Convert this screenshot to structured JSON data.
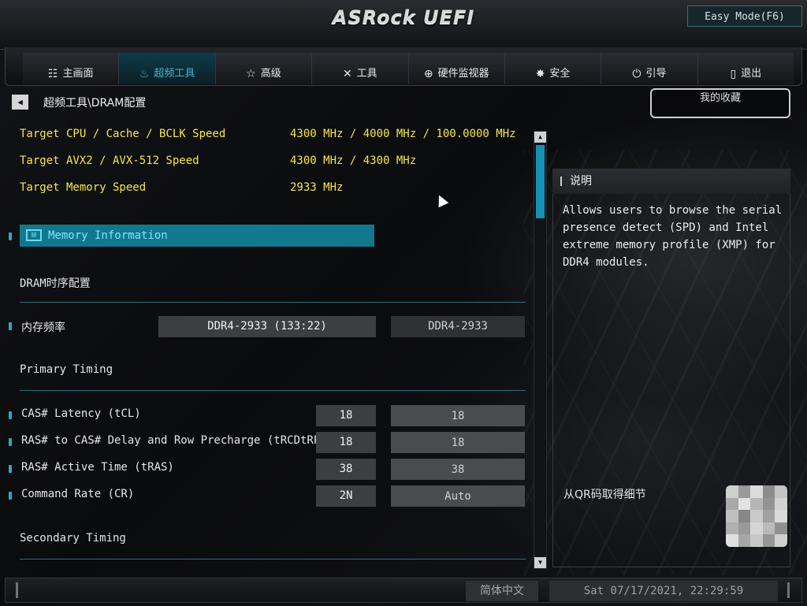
{
  "header": {
    "logo_text": "ASRock UEFI",
    "easy_mode_label": "Easy Mode(F6)"
  },
  "tabs": [
    {
      "label": "主画面",
      "icon": "list-icon",
      "glyph": "☷"
    },
    {
      "label": "超频工具",
      "icon": "flame-icon",
      "glyph": "♨"
    },
    {
      "label": "高级",
      "icon": "star-icon",
      "glyph": "☆"
    },
    {
      "label": "工具",
      "icon": "tools-icon",
      "glyph": "✕"
    },
    {
      "label": "硬件监视器",
      "icon": "target-icon",
      "glyph": "⊕"
    },
    {
      "label": "安全",
      "icon": "shield-gear-icon",
      "glyph": "✸"
    },
    {
      "label": "引导",
      "icon": "power-icon",
      "glyph": "⏻"
    },
    {
      "label": "退出",
      "icon": "exit-door-icon",
      "glyph": "▯"
    }
  ],
  "active_tab_index": 1,
  "breadcrumb": {
    "back_glyph": "◀",
    "path": "超频工具\\DRAM配置"
  },
  "favorites_label": "我的收藏",
  "targets": [
    {
      "label": "Target CPU / Cache / BCLK Speed",
      "value": "4300 MHz / 4000 MHz / 100.0000 MHz"
    },
    {
      "label": "Target AVX2 / AVX-512 Speed",
      "value": "4300 MHz / 4300 MHz"
    },
    {
      "label": "Target Memory Speed",
      "value": "2933 MHz"
    }
  ],
  "memory_info": {
    "label": "Memory Information",
    "icon": "memory-module-icon",
    "glyph": "▤"
  },
  "sections": {
    "dram_timing": "DRAM时序配置",
    "primary_timing": "Primary Timing",
    "secondary_timing": "Secondary Timing"
  },
  "memory_frequency": {
    "label": "内存频率",
    "current": "DDR4-2933 (133:22)",
    "selected": "DDR4-2933"
  },
  "primary_items": [
    {
      "label": "CAS# Latency (tCL)",
      "current": "18",
      "selected": "18"
    },
    {
      "label": "RAS# to CAS# Delay and Row Precharge (tRCDtRP)",
      "current": "18",
      "selected": "18"
    },
    {
      "label": "RAS# Active Time (tRAS)",
      "current": "38",
      "selected": "38"
    },
    {
      "label": "Command Rate (CR)",
      "current": "2N",
      "selected": "Auto"
    }
  ],
  "scrollbar": {
    "up_glyph": "▲",
    "down_glyph": "▼",
    "position_fraction": 0.0
  },
  "description": {
    "title": "说明",
    "text": "Allows users to browse the serial\npresence detect (SPD) and Intel\nextreme memory profile (XMP) for\nDDR4 modules."
  },
  "qr": {
    "label": "从QR码取得细节",
    "icon": "qr-code-icon"
  },
  "footer": {
    "language": "简体中文",
    "datetime": "Sat 07/17/2021, 22:29:59"
  },
  "colors": {
    "accent": "#12788d",
    "highlight_text": "#7fe4ff",
    "target_text": "#f4e74a",
    "active_tab_text": "#3fb6d6"
  }
}
